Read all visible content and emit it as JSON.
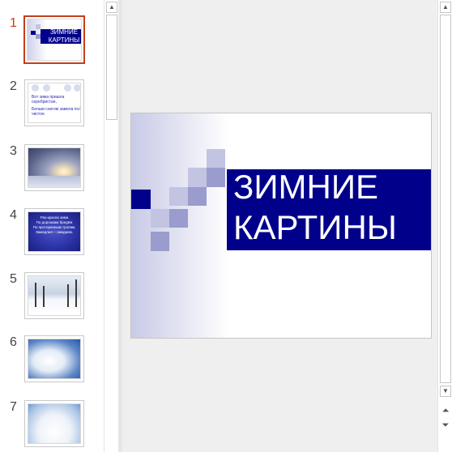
{
  "thumbnails": [
    {
      "number": "1",
      "title": "ЗИМНИЕ\nКАРТИНЫ"
    },
    {
      "number": "2",
      "bullets": [
        "Вот зима пришла серебристая,",
        "Белым снегом замела поле чистое."
      ]
    },
    {
      "number": "3"
    },
    {
      "number": "4",
      "text": "Раз-красна зима\nПо дорожкам бредём\nПо проторенным тропам,\nЗамедлил – ожидаем."
    },
    {
      "number": "5"
    },
    {
      "number": "6"
    },
    {
      "number": "7"
    }
  ],
  "slide": {
    "title": "ЗИМНИЕ\nКАРТИНЫ"
  },
  "colors": {
    "title_band": "#00008b",
    "selected_thumb_border": "#c43e1c",
    "square_light": "#c2c4e2",
    "square_mid": "#9a9cce",
    "square_dark": "#00008b"
  },
  "icons": {
    "scroll_up": "scroll-up-icon",
    "scroll_down": "scroll-down-icon",
    "previous_slide": "previous-slide-icon",
    "next_slide": "next-slide-icon"
  }
}
